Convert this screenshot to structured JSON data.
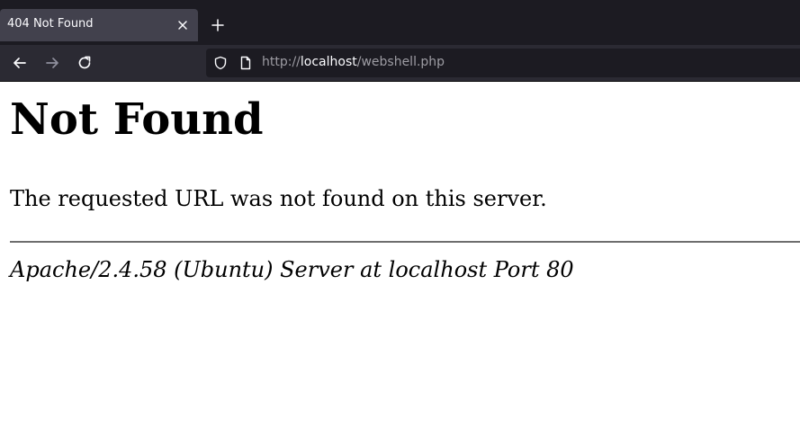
{
  "browser": {
    "tab": {
      "title": "404 Not Found"
    },
    "url": {
      "scheme": "http://",
      "host": "localhost",
      "path": "/webshell.php"
    }
  },
  "page": {
    "heading": "Not Found",
    "message": "The requested URL was not found on this server.",
    "server_signature": "Apache/2.4.58 (Ubuntu) Server at localhost Port 80"
  },
  "colors": {
    "tabstrip_bg": "#1c1b22",
    "active_tab_bg": "#42414d",
    "toolbar_bg": "#2b2a33",
    "urlbar_bg": "#1c1b22",
    "page_bg": "#ffffff"
  },
  "icons": {
    "tab_close": "close-icon",
    "new_tab": "plus-icon",
    "back": "back-arrow-icon",
    "forward": "forward-arrow-icon",
    "reload": "reload-icon",
    "tracking_protection": "shield-icon",
    "page_info": "page-icon"
  }
}
